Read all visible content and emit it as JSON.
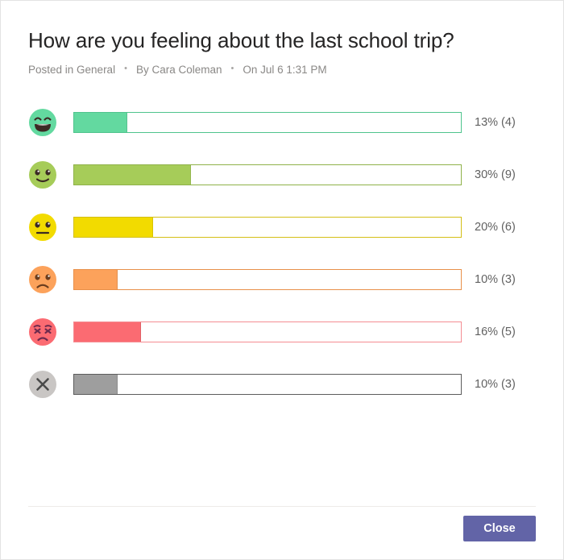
{
  "poll": {
    "title": "How are you feeling about the last school trip?",
    "meta": {
      "posted_in": "Posted in General",
      "author": "By Cara Coleman",
      "date": "On Jul 6 1:31 PM",
      "separator": "•"
    }
  },
  "footer": {
    "close_label": "Close"
  },
  "colors": {
    "accent": "#6264a7",
    "title_text": "#252424",
    "meta_text": "#8a8886",
    "pct_text": "#616161",
    "card_border": "#e3e3e3",
    "divider": "#edebe9"
  },
  "chart_data": {
    "type": "bar",
    "title": "How are you feeling about the last school trip?",
    "xlabel": "",
    "ylabel": "",
    "xlim": [
      0,
      100
    ],
    "grid": false,
    "legend": false,
    "orientation": "horizontal",
    "value_unit": "percent",
    "categories": [
      "grinning-face",
      "slightly-smiling-face",
      "neutral-face",
      "frowning-face",
      "distressed-face",
      "no-response"
    ],
    "values": [
      13,
      30,
      20,
      10,
      16,
      10
    ],
    "counts": [
      4,
      9,
      6,
      3,
      5,
      3
    ],
    "tick_labels": [
      "13% (4)",
      "30% (9)",
      "20% (6)",
      "10% (3)",
      "16% (5)",
      "10% (3)"
    ],
    "rows": [
      {
        "icon": "grinning-face-icon",
        "percent": 13,
        "count": 4,
        "label": "13% (4)",
        "fill": "#63d9a0",
        "border": "#4fc48d",
        "face": "#63d9a0",
        "feature": "#3b2a24",
        "bar_width": "13.5%"
      },
      {
        "icon": "slightly-smiling-face-icon",
        "percent": 30,
        "count": 9,
        "label": "30% (9)",
        "fill": "#a6cc59",
        "border": "#8fb24a",
        "face": "#a6cc59",
        "feature": "#3b2a24",
        "bar_width": "30%"
      },
      {
        "icon": "neutral-face-icon",
        "percent": 20,
        "count": 6,
        "label": "20% (6)",
        "fill": "#f2db00",
        "border": "#d4bf16",
        "face": "#f2db00",
        "feature": "#3b2a24",
        "bar_width": "20.3%"
      },
      {
        "icon": "frowning-face-icon",
        "percent": 10,
        "count": 3,
        "label": "10% (3)",
        "fill": "#fca25b",
        "border": "#e8904a",
        "face": "#fca25b",
        "feature": "#6b3d1e",
        "bar_width": "11%"
      },
      {
        "icon": "distressed-face-icon",
        "percent": 16,
        "count": 5,
        "label": "16% (5)",
        "fill": "#fb6b72",
        "border": "#f48d93",
        "face": "#fb6b72",
        "feature": "#6e2b4e",
        "bar_width": "17%"
      },
      {
        "icon": "no-response-icon",
        "percent": 10,
        "count": 3,
        "label": "10% (3)",
        "fill": "#9e9e9e",
        "border": "#5c5c5c",
        "face": "#c9c6c4",
        "feature": "#4a4a4a",
        "bar_width": "11%"
      }
    ]
  }
}
